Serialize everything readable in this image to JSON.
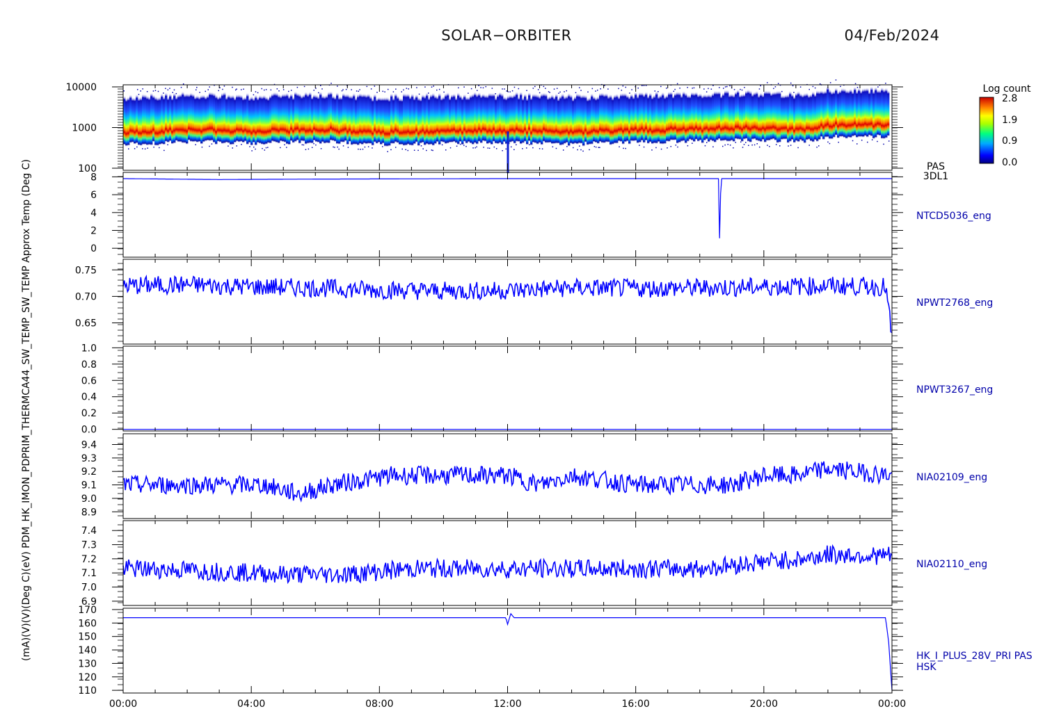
{
  "header": {
    "mission": "SOLAR−ORBITER",
    "date": "04/Feb/2024"
  },
  "colorbar": {
    "title": "Log count",
    "ticks": [
      "2.8",
      "1.9",
      "0.9",
      "0.0"
    ],
    "range": [
      0.0,
      2.8
    ]
  },
  "x_axis": {
    "ticks": [
      "00:00",
      "04:00",
      "08:00",
      "12:00",
      "16:00",
      "20:00",
      "00:00"
    ]
  },
  "y_axis_label_overlap": "(mA)(V)(V)(Deg C)(eV) PDM_HK_IMON_PDPRIM_THERMCA44_SW_TEMP_SW_TEMP Approx Temp (Deg C)",
  "chart_data": [
    {
      "type": "heatmap",
      "panel_name": "pas-energy-spectrogram",
      "y_ticks": [
        "10000",
        "1000",
        "100"
      ],
      "ylim": [
        100,
        10000
      ],
      "y_scale": "log",
      "labels": [
        "PAS",
        "3DL1"
      ],
      "peak_energy_eV_profile": {
        "x_hours": [
          0,
          1,
          2,
          4,
          6,
          8,
          10,
          12,
          14,
          16,
          18,
          20,
          21.3,
          22,
          24
        ],
        "y": [
          1000,
          1050,
          1150,
          1050,
          1150,
          1000,
          1050,
          1100,
          1000,
          1100,
          1200,
          1250,
          1150,
          1500,
          1550
        ]
      }
    },
    {
      "type": "line",
      "panel_name": "ntcd5036-panel",
      "label": "NTCD5036_eng",
      "y_ticks": [
        "8",
        "6",
        "4",
        "2",
        "0"
      ],
      "ylim": [
        -1,
        8.5
      ],
      "x_hours": [
        0,
        3,
        6,
        12,
        18.6,
        18.62,
        18.66,
        24
      ],
      "y": [
        7.8,
        7.7,
        7.75,
        7.8,
        7.8,
        0.0,
        7.8,
        7.8
      ]
    },
    {
      "type": "line",
      "panel_name": "npwt2768-panel",
      "label": "NPWT2768_eng",
      "y_ticks": [
        "0.75",
        "0.70",
        "0.65"
      ],
      "ylim": [
        0.61,
        0.77
      ],
      "x_hours": [
        0,
        2,
        4,
        6,
        8,
        10,
        12,
        14,
        16,
        18,
        20,
        22,
        23.8,
        24
      ],
      "y": [
        0.72,
        0.722,
        0.718,
        0.716,
        0.712,
        0.71,
        0.711,
        0.716,
        0.715,
        0.716,
        0.718,
        0.72,
        0.718,
        0.625
      ]
    },
    {
      "type": "line",
      "panel_name": "npwt3267-panel",
      "label": "NPWT3267_eng",
      "y_ticks": [
        "1.0",
        "0.8",
        "0.6",
        "0.4",
        "0.2",
        "0.0"
      ],
      "ylim": [
        -0.02,
        1.02
      ],
      "x_hours": [
        0,
        24
      ],
      "y": [
        0.0,
        0.0
      ]
    },
    {
      "type": "line",
      "panel_name": "nia02109-panel",
      "label": "NIA02109_eng",
      "y_ticks": [
        "9.4",
        "9.3",
        "9.2",
        "9.1",
        "9.0",
        "8.9"
      ],
      "ylim": [
        8.85,
        9.48
      ],
      "x_hours": [
        0,
        1.5,
        3,
        4.4,
        5.5,
        6.5,
        8.4,
        10,
        12,
        13,
        14,
        16,
        18,
        19,
        20,
        21,
        21.6,
        22,
        24
      ],
      "y": [
        9.1,
        9.1,
        9.1,
        9.1,
        9.03,
        9.1,
        9.17,
        9.17,
        9.17,
        9.1,
        9.17,
        9.1,
        9.1,
        9.1,
        9.17,
        9.17,
        9.2,
        9.22,
        9.17
      ]
    },
    {
      "type": "line",
      "panel_name": "nia02110-panel",
      "label": "NIA02110_eng",
      "y_ticks": [
        "7.4",
        "7.3",
        "7.2",
        "7.1",
        "7.0",
        "6.9"
      ],
      "ylim": [
        6.87,
        7.47
      ],
      "x_hours": [
        0,
        2,
        4,
        5,
        7,
        9,
        12,
        14,
        16,
        18,
        20,
        21.3,
        22,
        24
      ],
      "y": [
        7.13,
        7.12,
        7.1,
        7.09,
        7.09,
        7.13,
        7.13,
        7.13,
        7.13,
        7.13,
        7.18,
        7.2,
        7.23,
        7.22
      ]
    },
    {
      "type": "line",
      "panel_name": "hk-i-plus-28v-panel",
      "label": "HK_I_PLUS_28V_PRI PAS",
      "label2": "HSK",
      "y_ticks": [
        "170",
        "160",
        "150",
        "140",
        "130",
        "120",
        "110"
      ],
      "ylim": [
        108,
        171
      ],
      "x_hours": [
        0,
        11.95,
        12.0,
        12.1,
        12.2,
        23.8,
        23.9,
        24
      ],
      "y": [
        164,
        164,
        159,
        167,
        164,
        164,
        145,
        110
      ]
    }
  ]
}
